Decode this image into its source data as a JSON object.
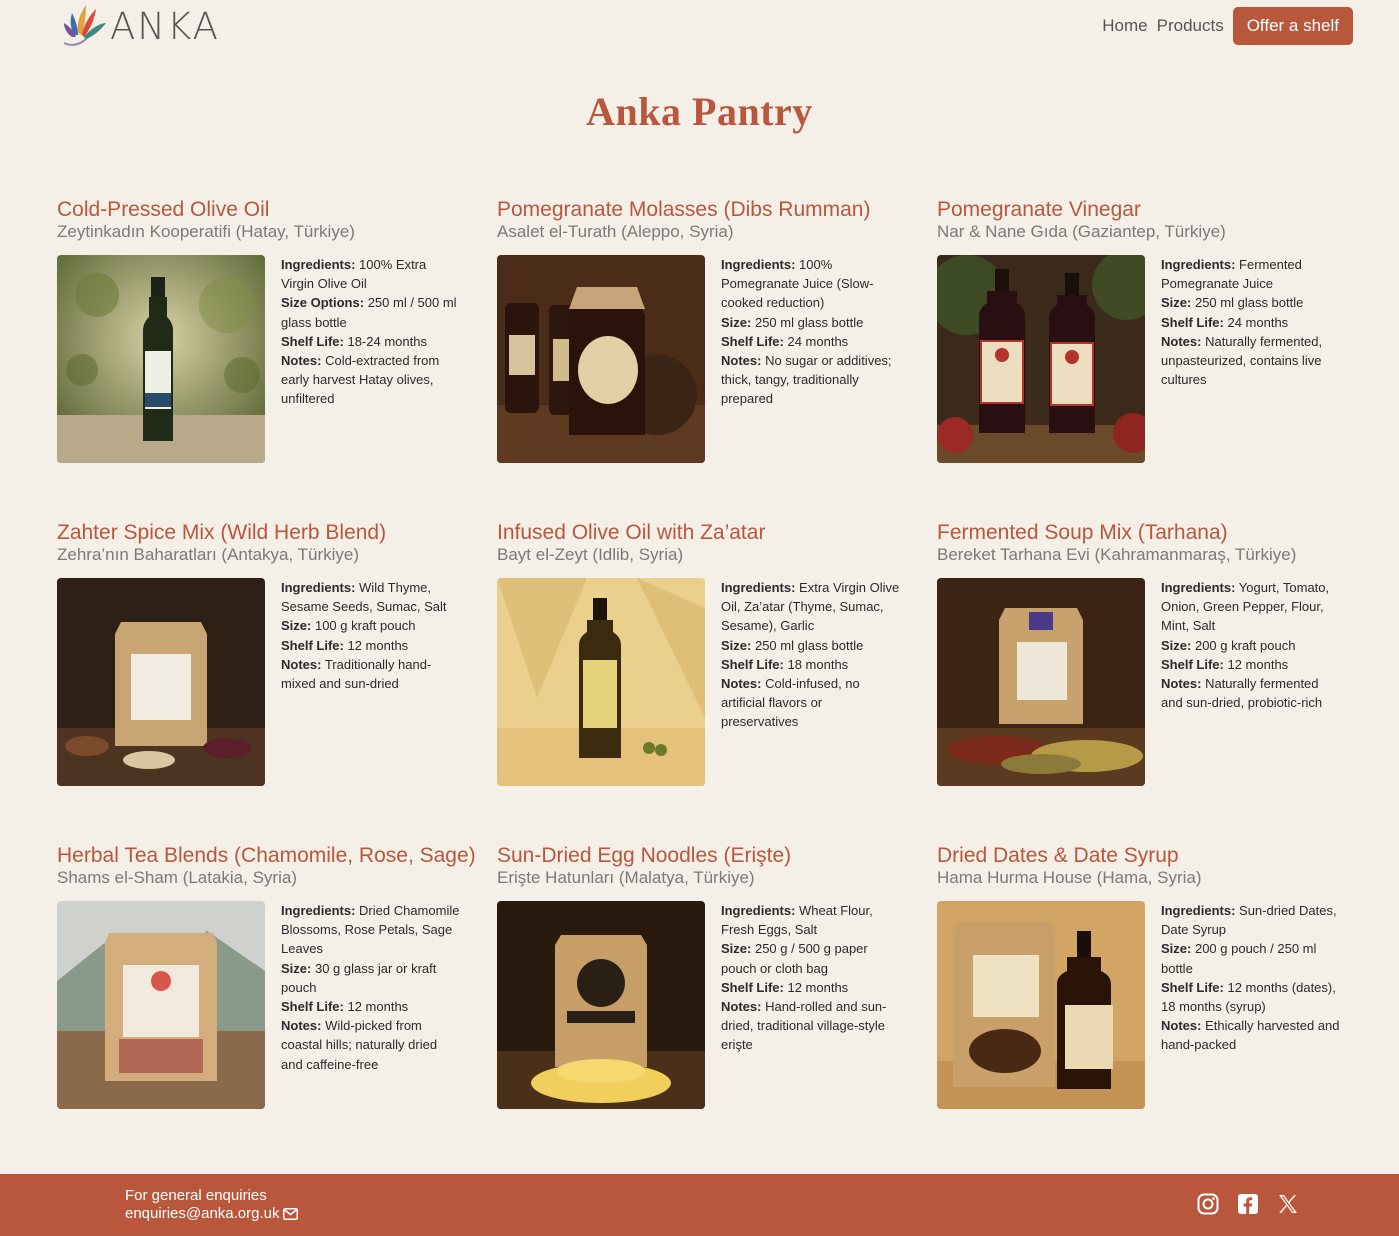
{
  "header": {
    "logo_text": "ANKA",
    "nav": {
      "home": "Home",
      "products": "Products",
      "offer": "Offer a shelf"
    }
  },
  "page_title": "Anka Pantry",
  "colors": {
    "accent": "#b9573d",
    "background": "#f4efe7"
  },
  "labels": {
    "ingredients": "Ingredients:",
    "size_options": "Size Options:",
    "size": "Size:",
    "shelf_life": "Shelf Life:",
    "notes": "Notes:"
  },
  "products": [
    {
      "name": "Cold-Pressed Olive Oil",
      "producer": "Zeytinkadın Kooperatifi (Hatay, Türkiye)",
      "ingredients": "100% Extra Virgin Olive Oil",
      "size": "250 ml / 500 ml glass bottle",
      "shelf_life": "18-24 months",
      "notes": "Cold-extracted from early harvest Hatay olives, unfiltered",
      "image": "olive-oil-bottle-photo"
    },
    {
      "name": "Pomegranate Molasses (Dibs Rumman)",
      "producer": "Asalet el-Turath (Aleppo, Syria)",
      "ingredients": "100% Pomegranate Juice (Slow-cooked reduction)",
      "size": "250 ml glass bottle",
      "shelf_life": "24 months",
      "notes": "No sugar or additives; thick, tangy, traditionally prepared",
      "image": "pomegranate-molasses-jars-photo"
    },
    {
      "name": "Pomegranate Vinegar",
      "producer": "Nar & Nane Gıda (Gaziantep, Türkiye)",
      "ingredients": "Fermented Pomegranate Juice",
      "size": "250 ml glass bottle",
      "shelf_life": "24 months",
      "notes": "Naturally fermented, unpasteurized, contains live cultures",
      "image": "pomegranate-vinegar-bottles-photo"
    },
    {
      "name": "Zahter Spice Mix (Wild Herb Blend)",
      "producer": "Zehra’nın Baharatları (Antakya, Türkiye)",
      "ingredients": "Wild Thyme, Sesame Seeds, Sumac, Salt",
      "size": "100 g kraft pouch",
      "shelf_life": "12 months",
      "notes": "Traditionally hand-mixed and sun-dried",
      "image": "zahter-pouch-photo"
    },
    {
      "name": "Infused Olive Oil with Za’atar",
      "producer": "Bayt el-Zeyt (Idlib, Syria)",
      "ingredients": "Extra Virgin Olive Oil, Za’atar (Thyme, Sumac, Sesame), Garlic",
      "size": "250 ml glass bottle",
      "shelf_life": "18 months",
      "notes": "Cold-infused, no artificial flavors or preservatives",
      "image": "zaatar-oil-bottle-photo"
    },
    {
      "name": "Fermented Soup Mix (Tarhana)",
      "producer": "Bereket Tarhana Evi (Kahramanmaraş, Türkiye)",
      "ingredients": "Yogurt, Tomato, Onion, Green Pepper, Flour, Mint, Salt",
      "size": "200 g kraft pouch",
      "shelf_life": "12 months",
      "notes": "Naturally fermented and sun-dried, probiotic-rich",
      "image": "tarhana-pouch-photo"
    },
    {
      "name": "Herbal Tea Blends (Chamomile, Rose, Sage)",
      "producer": "Shams el-Sham (Latakia, Syria)",
      "ingredients": "Dried Chamomile Blossoms, Rose Petals, Sage Leaves",
      "size": "30 g glass jar or kraft pouch",
      "shelf_life": "12 months",
      "notes": "Wild-picked from coastal hills; naturally dried and caffeine-free",
      "image": "herbal-tea-pouch-photo"
    },
    {
      "name": "Sun-Dried Egg Noodles (Erişte)",
      "producer": "Erişte Hatunları (Malatya, Türkiye)",
      "ingredients": "Wheat Flour, Fresh Eggs, Salt",
      "size": "250 g / 500 g paper pouch or cloth bag",
      "shelf_life": "12 months",
      "notes": "Hand-rolled and sun-dried, traditional village-style erişte",
      "image": "eriste-pouch-photo"
    },
    {
      "name": "Dried Dates & Date Syrup",
      "producer": "Hama Hurma House (Hama, Syria)",
      "ingredients": "Sun-dried Dates, Date Syrup",
      "size": "200 g pouch / 250 ml bottle",
      "shelf_life": "12 months (dates), 18 months (syrup)",
      "notes": "Ethically harvested and hand-packed",
      "image": "dates-and-syrup-photo"
    }
  ],
  "footer": {
    "enquiries_label": "For general enquiries",
    "email": "enquiries@anka.org.uk",
    "socials": [
      "instagram-icon",
      "facebook-icon",
      "x-icon"
    ]
  }
}
